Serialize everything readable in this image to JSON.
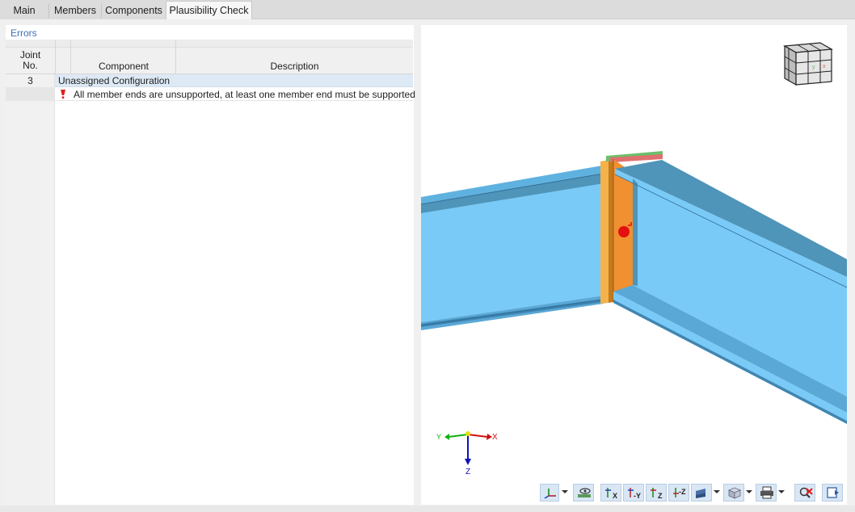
{
  "tabs": [
    {
      "label": "Main",
      "active": false
    },
    {
      "label": "Members",
      "active": false
    },
    {
      "label": "Components",
      "active": false
    },
    {
      "label": "Plausibility Check",
      "active": true
    }
  ],
  "errors_panel": {
    "title": "Errors",
    "columns": {
      "joint_no": "Joint\nNo.",
      "component": "Component",
      "description": "Description"
    },
    "rows": [
      {
        "joint_no": "3",
        "group_label": "Unassigned Configuration"
      },
      {
        "severity_icon": "error-exclamation-icon",
        "description": "All member ends are unsupported, at least one member end must be supported"
      }
    ]
  },
  "view3d": {
    "axis_labels": {
      "x": "X",
      "y": "Y",
      "z": "Z"
    },
    "colors": {
      "beam": "#79caf7",
      "beam_dark": "#4f94b9",
      "plate": "#f09030",
      "error_marker": "#e31010"
    }
  },
  "toolbar_icons": [
    "axes-dropdown-icon",
    "view-visibility-icon",
    "view-x-icon",
    "view-minus-y-icon",
    "view-z-icon",
    "view-minus-z-icon",
    "display-mode-dropdown-icon",
    "render-box-dropdown-icon",
    "print-dropdown-icon",
    "reset-view-icon",
    "exit-view-icon"
  ]
}
